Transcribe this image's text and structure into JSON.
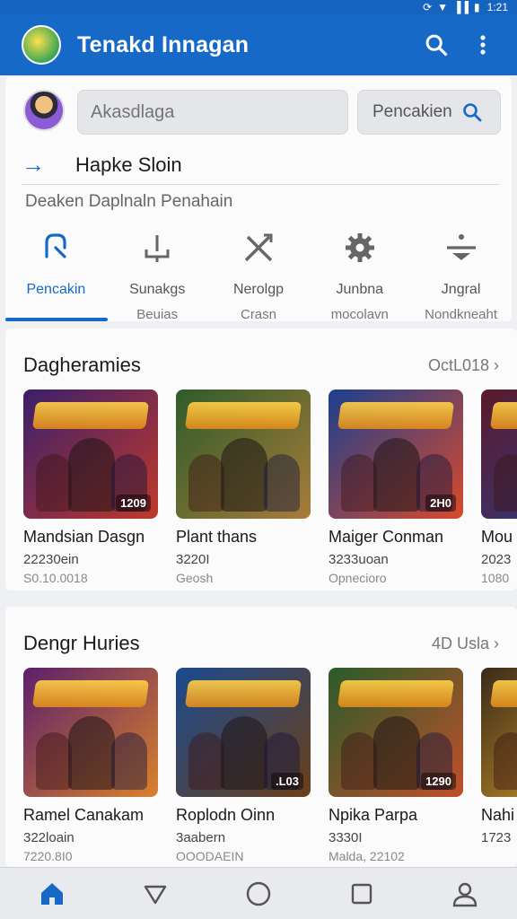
{
  "status_bar": {
    "time": "1:21"
  },
  "app": {
    "title": "Tenakd Innagan",
    "accent": "#1769c7"
  },
  "header": {
    "search_placeholder": "Akasdlaga",
    "search_button_label": "Pencakien",
    "recent_label": "Hapke Sloin",
    "subtitle": "Deaken Daplnaln Penahain"
  },
  "categories": [
    {
      "label": "Pencakin",
      "sub": "",
      "icon": "controller-outline-icon",
      "active": true
    },
    {
      "label": "Sunakgs",
      "sub": "Beuias",
      "icon": "joystick-icon",
      "active": false
    },
    {
      "label": "Nerolgp",
      "sub": "Crasn",
      "icon": "swords-icon",
      "active": false
    },
    {
      "label": "Junbna",
      "sub": "mocolavn",
      "icon": "gear-icon",
      "active": false
    },
    {
      "label": "Jngral",
      "sub": "Nondkneaht",
      "icon": "divide-icon",
      "active": false
    }
  ],
  "section1": {
    "title": "Dagheramies",
    "more_label": "OctL018 ›",
    "tiles": [
      {
        "name": "Mandsian Dasgn",
        "line2": "22230ein",
        "line3": "S0.10.0018",
        "badge": "1209",
        "colors": [
          "#3a1f6b",
          "#c0392b"
        ]
      },
      {
        "name": "Plant thans",
        "line2": "3220I",
        "line3": "Geosh",
        "badge": "",
        "colors": [
          "#2e5b2a",
          "#a87c3a"
        ]
      },
      {
        "name": "Maiger Conman",
        "line2": "3233uoan",
        "line3": "Opnecioro",
        "badge": "2H0",
        "colors": [
          "#1b3f8f",
          "#d94a2b"
        ]
      },
      {
        "name": "Mou",
        "line2": "2023",
        "line3": "1080",
        "badge": "",
        "colors": [
          "#5b1a2a",
          "#2a3f8f"
        ]
      }
    ]
  },
  "section2": {
    "title": "Dengr Huries",
    "more_label": "4D Usla ›",
    "tiles": [
      {
        "name": "Ramel Canakam",
        "line2": "322loain",
        "line3": "7220.8I0",
        "badge": "",
        "colors": [
          "#5b1f6b",
          "#d9822b"
        ]
      },
      {
        "name": "Roplodn Oinn",
        "line2": "3aabern",
        "line3": "OOODAEIN",
        "badge": ".L03",
        "colors": [
          "#1b4a8f",
          "#6b3f1a"
        ]
      },
      {
        "name": "Npika Parpa",
        "line2": "3330I",
        "line3": "Malda, 22102",
        "badge": "1290",
        "colors": [
          "#2a5b2a",
          "#c0502b"
        ]
      },
      {
        "name": "Nahi",
        "line2": "1723",
        "line3": "",
        "badge": "",
        "colors": [
          "#3a2a1a",
          "#d9a22b"
        ]
      }
    ]
  },
  "bottom_nav": [
    {
      "icon": "home-icon",
      "active": true
    },
    {
      "icon": "back-triangle-icon",
      "active": false
    },
    {
      "icon": "circle-home-icon",
      "active": false
    },
    {
      "icon": "square-recents-icon",
      "active": false
    },
    {
      "icon": "profile-icon",
      "active": false
    }
  ]
}
